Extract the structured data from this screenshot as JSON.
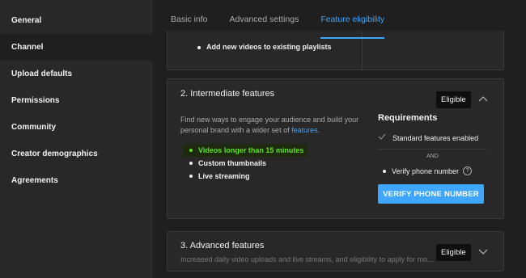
{
  "sidebar": {
    "items": [
      {
        "label": "General"
      },
      {
        "label": "Channel"
      },
      {
        "label": "Upload defaults"
      },
      {
        "label": "Permissions"
      },
      {
        "label": "Community"
      },
      {
        "label": "Creator demographics"
      },
      {
        "label": "Agreements"
      }
    ],
    "active_index": 1
  },
  "tabs": [
    {
      "label": "Basic info"
    },
    {
      "label": "Advanced settings"
    },
    {
      "label": "Feature eligibility"
    }
  ],
  "top_card": {
    "bullet": "Add new videos to existing playlists"
  },
  "intermediate": {
    "title": "2. Intermediate features",
    "badge": "Eligible",
    "description": "Find new ways to engage your audience and build your personal brand with a wider set of ",
    "description_link": "features",
    "description_end": ".",
    "features": [
      "Videos longer than 15 minutes",
      "Custom thumbnails",
      "Live streaming"
    ],
    "requirements": {
      "title": "Requirements",
      "item1": "Standard features enabled",
      "and_label": "AND",
      "item2": "Verify phone number",
      "help_icon": "?",
      "button": "VERIFY PHONE NUMBER"
    }
  },
  "advanced": {
    "title": "3. Advanced features",
    "badge": "Eligible",
    "description": "Increased daily video uploads and live streams, and eligibility to apply for mo..."
  },
  "colors": {
    "accent": "#3ea6ff",
    "highlight_text": "#5ee21d",
    "background": "#1f1f1f",
    "card": "#282828"
  }
}
